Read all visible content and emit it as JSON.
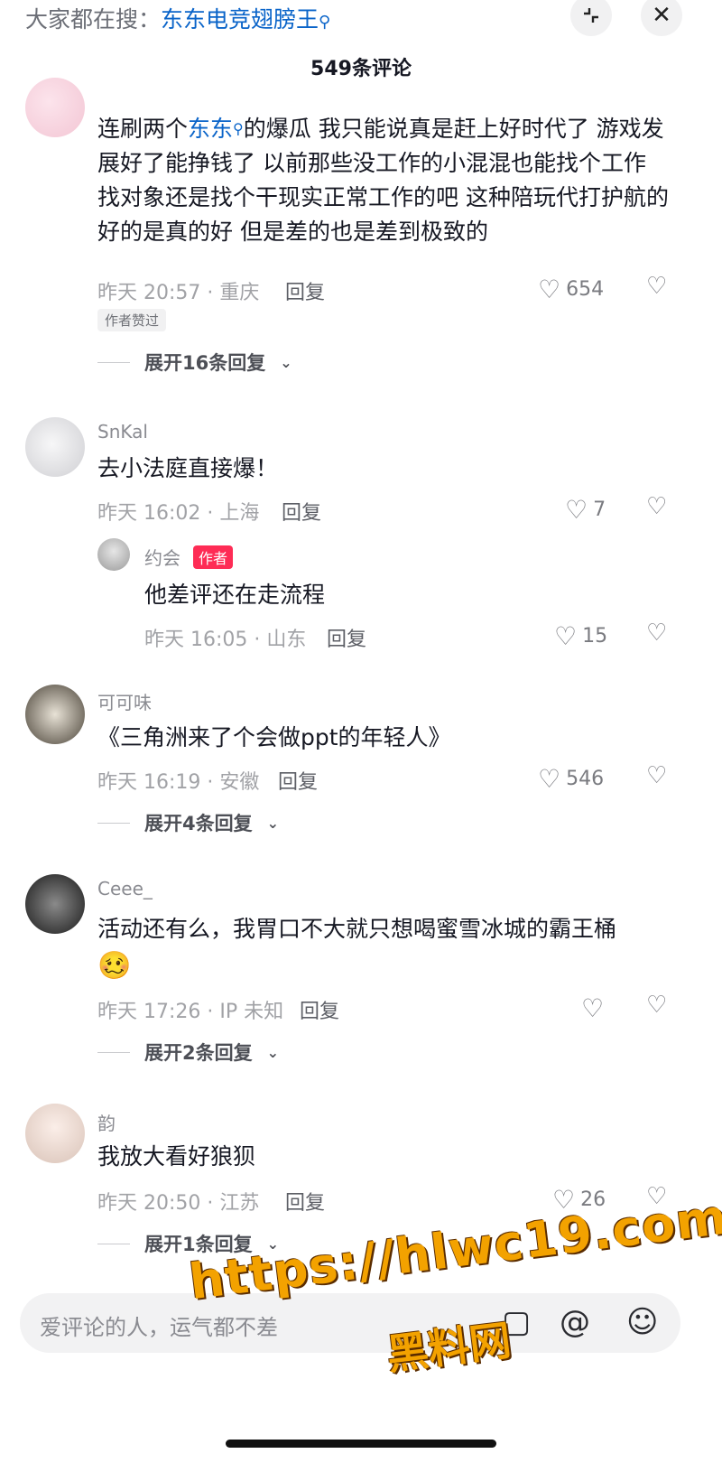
{
  "top_bar": {
    "search_prefix": "大家都在搜：",
    "search_keyword": "东东电竞翅膀王",
    "collapse_label": "⌐",
    "close_label": "✕"
  },
  "comment_count": "549条评论",
  "comments": [
    {
      "username": "",
      "text_before": "连刷两个",
      "text_link": "东东",
      "text_after": "的爆瓜 我只能说真是赶上好时代了 游戏发展好了能挣钱了 以前那些没工作的小混混也能找个工作 找对象还是找个干现实正常工作的吧 这种陪玩代打护航的 好的是真的好 但是差的也是差到极致的",
      "meta": "昨天 20:57 · 重庆",
      "reply": "回复",
      "likes": "654",
      "tag": "作者赞过",
      "expand": "展开16条回复"
    },
    {
      "username": "SnKal",
      "text": "去小法庭直接爆！",
      "meta": "昨天 16:02 · 上海",
      "reply": "回复",
      "likes": "7",
      "sub_reply": {
        "username": "约会",
        "tag": "作者",
        "text": "他差评还在走流程",
        "meta": "昨天 16:05 · 山东",
        "reply": "回复",
        "likes": "15"
      }
    },
    {
      "username": "可可味",
      "text": "《三角洲来了个会做ppt的年轻人》",
      "meta": "昨天 16:19 · 安徽",
      "reply": "回复",
      "likes": "546",
      "expand": "展开4条回复"
    },
    {
      "username": "Ceee_",
      "text": "活动还有么，我胃口不大就只想喝蜜雪冰城的霸王桶",
      "emoji": "🥴",
      "meta": "昨天 17:26 · IP 未知",
      "reply": "回复",
      "likes": "",
      "expand": "展开2条回复"
    },
    {
      "username": "韵",
      "text": "我放大看好狼狈",
      "meta": "昨天 20:50 · 江苏",
      "reply": "回复",
      "likes": "26",
      "expand": "展开1条回复"
    }
  ],
  "input": {
    "placeholder": "爱评论的人，运气都不差"
  },
  "watermark": {
    "line1": "https://hlwc19.com",
    "line2": "黑料网"
  },
  "colors": {
    "link": "#0a64c9",
    "author_tag": "#fe2c55",
    "watermark": "#f3a200"
  }
}
